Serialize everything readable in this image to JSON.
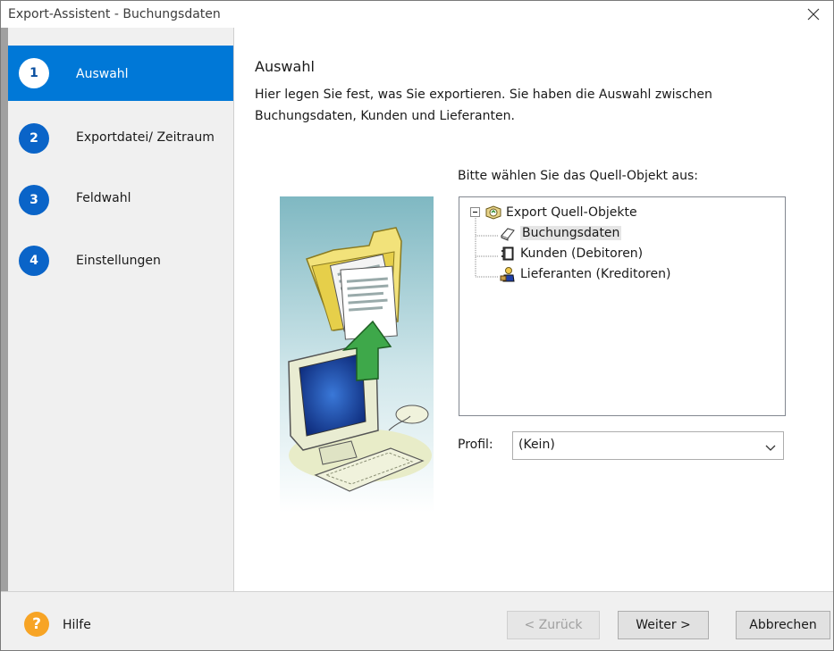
{
  "window": {
    "title": "Export-Assistent - Buchungsdaten"
  },
  "steps": [
    {
      "num": "1",
      "label": "Auswahl",
      "active": true
    },
    {
      "num": "2",
      "label": "Exportdatei/ Zeitraum",
      "active": false
    },
    {
      "num": "3",
      "label": "Feldwahl",
      "active": false
    },
    {
      "num": "4",
      "label": "Einstellungen",
      "active": false
    }
  ],
  "main": {
    "heading": "Auswahl",
    "description": "Hier legen Sie fest, was Sie exportieren. Sie haben die Auswahl zwischen Buchungsdaten, Kunden und Lieferanten.",
    "prompt": "Bitte wählen Sie das Quell-Objekt aus:",
    "tree": {
      "root": "Export Quell-Objekte",
      "children": [
        "Buchungsdaten",
        "Kunden (Debitoren)",
        "Lieferanten (Kreditoren)"
      ],
      "selected": "Buchungsdaten"
    },
    "profil_label": "Profil:",
    "profil_value": "(Kein)"
  },
  "footer": {
    "help_label": "Hilfe",
    "back_label": "< Zurück",
    "next_label": "Weiter >",
    "cancel_label": "Abbrechen"
  },
  "colors": {
    "active_step": "#0078d7",
    "step_circle": "#0a64c8",
    "help_icon": "#f7a425"
  },
  "icons": {
    "close": "close-icon",
    "help": "help-icon",
    "dropdown": "chevron-down-icon",
    "tree_root": "database-icon",
    "tree_booking": "book-icon",
    "tree_customers": "card-file-icon",
    "tree_suppliers": "supplier-icon"
  }
}
